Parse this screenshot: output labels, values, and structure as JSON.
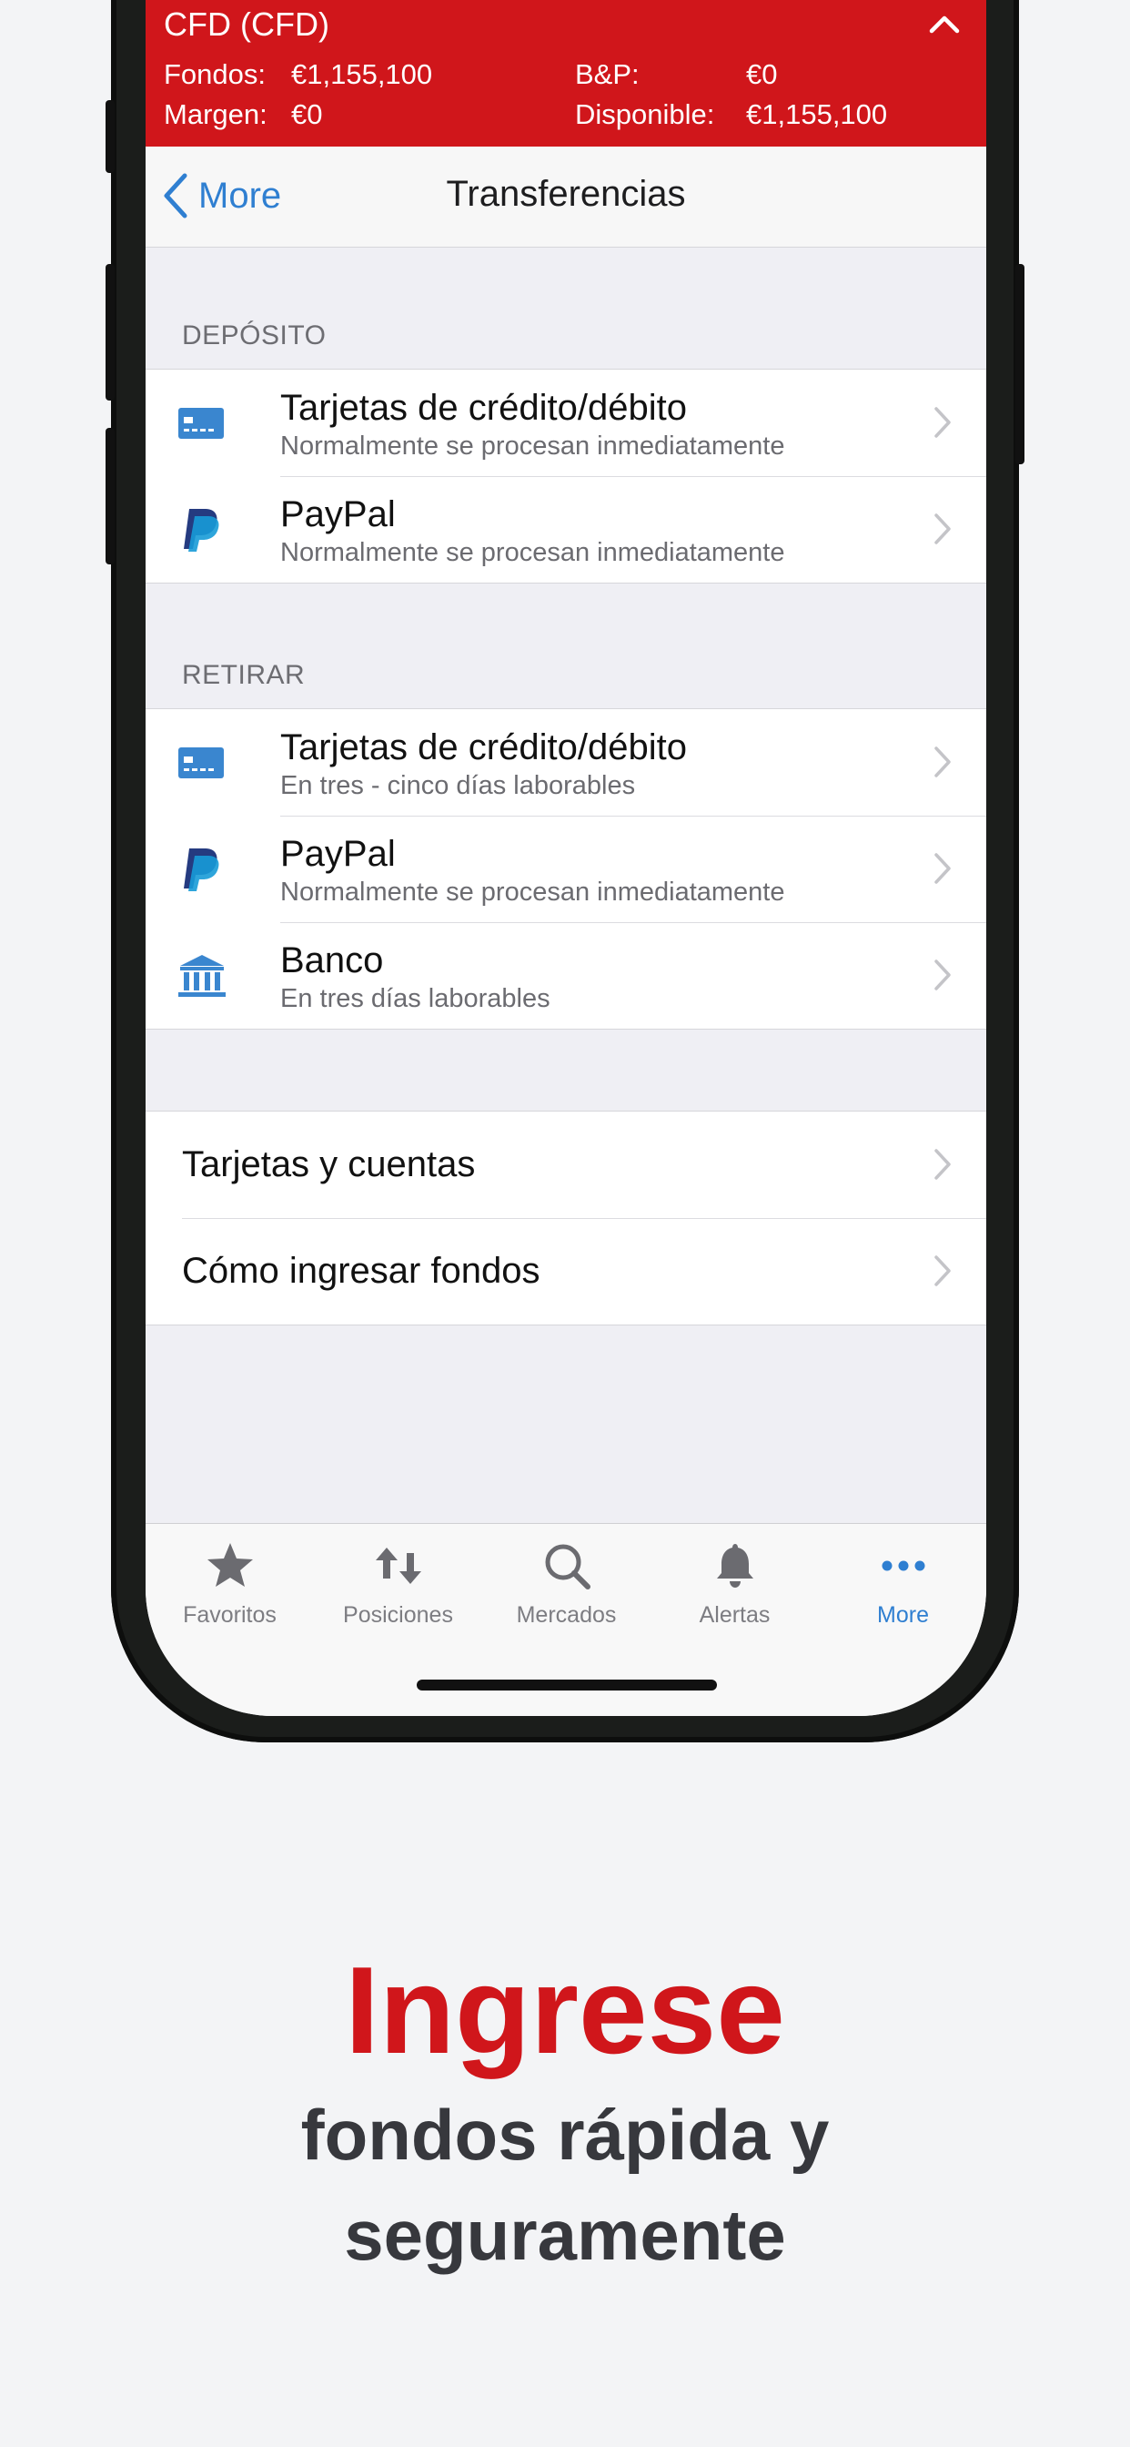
{
  "account": {
    "title": "CFD (CFD)",
    "fondos_label": "Fondos:",
    "fondos_value": "€1,155,100",
    "margen_label": "Margen:",
    "margen_value": "€0",
    "bp_label": "B&P:",
    "bp_value": "€0",
    "disponible_label": "Disponible:",
    "disponible_value": "€1,155,100"
  },
  "nav": {
    "back_label": "More",
    "title": "Transferencias"
  },
  "deposit": {
    "header": "DEPÓSITO",
    "items": [
      {
        "icon": "credit-card-icon",
        "title": "Tarjetas de crédito/débito",
        "subtitle": "Normalmente se procesan inmediatamente"
      },
      {
        "icon": "paypal-icon",
        "title": "PayPal",
        "subtitle": "Normalmente se procesan inmediatamente"
      }
    ]
  },
  "withdraw": {
    "header": "RETIRAR",
    "items": [
      {
        "icon": "credit-card-icon",
        "title": "Tarjetas de crédito/débito",
        "subtitle": "En tres - cinco días laborables"
      },
      {
        "icon": "paypal-icon",
        "title": "PayPal",
        "subtitle": "Normalmente se procesan inmediatamente"
      },
      {
        "icon": "bank-icon",
        "title": "Banco",
        "subtitle": "En tres días laborables"
      }
    ]
  },
  "other": {
    "items": [
      {
        "title": "Tarjetas y cuentas"
      },
      {
        "title": "Cómo ingresar fondos"
      }
    ]
  },
  "tabs": [
    {
      "icon": "star-icon",
      "label": "Favoritos"
    },
    {
      "icon": "up-down-arrows-icon",
      "label": "Posiciones"
    },
    {
      "icon": "search-icon",
      "label": "Mercados"
    },
    {
      "icon": "bell-icon",
      "label": "Alertas"
    },
    {
      "icon": "more-dots-icon",
      "label": "More",
      "active": true
    }
  ],
  "marketing": {
    "headline": "Ingrese",
    "line1": "fondos rápida y",
    "line2": "seguramente"
  },
  "colors": {
    "brand_red": "#d0161b",
    "accent_blue": "#2f7fd1",
    "icon_blue": "#3a86cf"
  }
}
